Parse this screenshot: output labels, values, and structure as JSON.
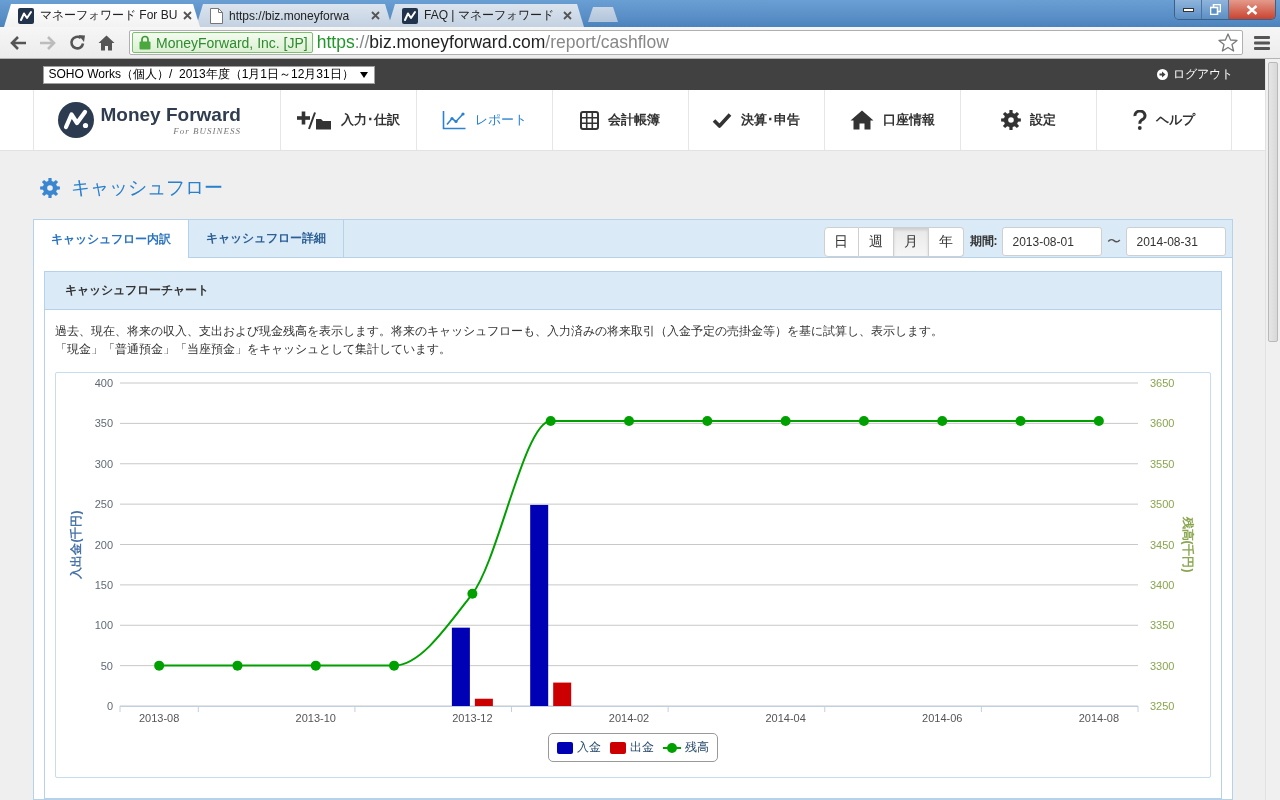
{
  "browser": {
    "tabs": [
      {
        "title": "マネーフォワード For BU",
        "kind": "app",
        "selected": true
      },
      {
        "title": "https://biz.moneyforwa",
        "kind": "page",
        "selected": false
      },
      {
        "title": "FAQ | マネーフォワード",
        "kind": "app",
        "selected": false
      }
    ],
    "can_go_forward": false,
    "ev_badge": "MoneyForward, Inc. [JP]",
    "url": [
      {
        "text": "https",
        "kind": "scheme"
      },
      {
        "text": "://",
        "kind": "plain"
      },
      {
        "text": "biz.moneyforward.com",
        "kind": "host"
      },
      {
        "text": "/report/cashflow",
        "kind": "path"
      }
    ]
  },
  "top_bar": {
    "office_select": "SOHO Works（個人）/  2013年度（1月1日～12月31日）",
    "logout": "ログアウト"
  },
  "header": {
    "logo": {
      "name": "Money Forward",
      "tagline": "For BUSINESS"
    },
    "nav": [
      {
        "label": "入力･仕訳",
        "kind": "entry",
        "selected": false
      },
      {
        "label": "レポート",
        "kind": "report",
        "selected": true
      },
      {
        "label": "会計帳簿",
        "kind": "ledger",
        "selected": false
      },
      {
        "label": "決算･申告",
        "kind": "closing",
        "selected": false
      },
      {
        "label": "口座情報",
        "kind": "accounts",
        "selected": false
      },
      {
        "label": "設定",
        "kind": "settings",
        "selected": false
      },
      {
        "label": "ヘルプ",
        "kind": "help",
        "selected": false
      }
    ]
  },
  "page_title": "キャッシュフロー",
  "panel": {
    "tabs": [
      {
        "label": "キャッシュフロー内訳",
        "selected": true
      },
      {
        "label": "キャッシュフロー詳細",
        "selected": false
      }
    ],
    "period_buttons": [
      {
        "label": "日",
        "selected": false
      },
      {
        "label": "週",
        "selected": false
      },
      {
        "label": "月",
        "selected": true
      },
      {
        "label": "年",
        "selected": false
      }
    ],
    "period_label": "期間:",
    "date_from": "2013-08-01",
    "date_separator": "〜",
    "date_to": "2014-08-31",
    "card": {
      "title": "キャッシュフローチャート",
      "description": [
        "過去、現在、将来の収入、支出および現金残高を表示します。将来のキャッシュフローも、入力済みの将来取引（入金予定の売掛金等）を基に試算し、表示します。",
        "「現金」「普通預金」「当座預金」をキャッシュとして集計しています。"
      ],
      "chart_data": {
        "type": "bar",
        "stacked": false,
        "grid": true,
        "legend": "bottom",
        "ylabel": "入出金(千円)",
        "y2label": "残高(千円)",
        "categories": [
          "2013-08",
          null,
          "2013-10",
          null,
          "2013-12",
          null,
          "2014-02",
          null,
          "2014-04",
          null,
          "2014-06",
          null,
          "2014-08"
        ],
        "ylim": [
          0,
          400
        ],
        "yticks": [
          0,
          50,
          100,
          150,
          200,
          250,
          300,
          350,
          400
        ],
        "y2lim": [
          3250,
          3650
        ],
        "y2ticks": [
          3250,
          3300,
          3350,
          3400,
          3450,
          3500,
          3550,
          3600,
          3650
        ],
        "series": [
          {
            "name": "入金",
            "color": "#0000b4",
            "values": [
              0,
              0,
              0,
              0,
              97,
              249,
              0,
              0,
              0,
              0,
              0,
              0,
              0
            ]
          },
          {
            "name": "出金",
            "color": "#cc0000",
            "values": [
              0,
              0,
              0,
              0,
              9,
              29,
              0,
              0,
              0,
              0,
              0,
              0,
              0
            ]
          },
          {
            "name": "残高",
            "type": "line",
            "axis": "y2",
            "marker": true,
            "color": "#00a000",
            "values": [
              3300,
              3300,
              3300,
              3300,
              3389,
              3603,
              3603,
              3603,
              3603,
              3603,
              3603,
              3603,
              3603
            ]
          }
        ]
      }
    }
  }
}
